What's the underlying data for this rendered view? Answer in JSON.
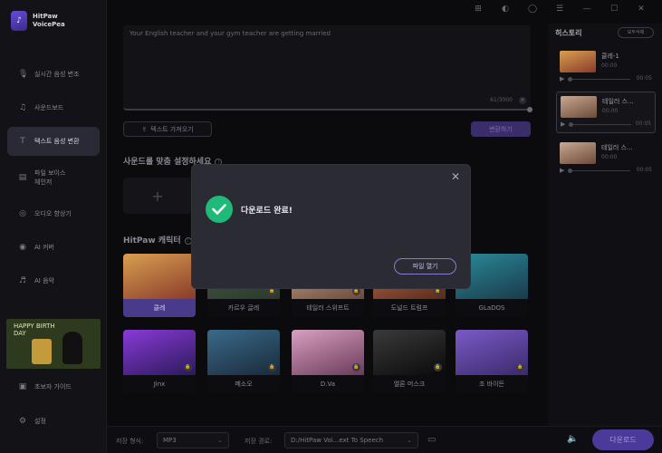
{
  "app": {
    "name_line1": "HitPaw",
    "name_line2": "VoicePea"
  },
  "sidebar": {
    "items": [
      {
        "label": "실시간 음성 변조",
        "icon": "mic-icon"
      },
      {
        "label": "사운드보드",
        "icon": "soundboard-icon"
      },
      {
        "label": "텍스트 음성 변환",
        "icon": "text-speech-icon",
        "active": true
      },
      {
        "label_line1": "파일 보이스",
        "label_line2": "체인저",
        "icon": "file-voice-icon"
      },
      {
        "label": "오디오 향상기",
        "icon": "audio-enhance-icon"
      },
      {
        "label": "AI 커버",
        "icon": "ai-cover-icon"
      },
      {
        "label": "AI 음악",
        "icon": "ai-music-icon"
      }
    ],
    "promo": {
      "line1": "HAPPY BIRTH",
      "line2": "DAY"
    },
    "guide": "초보자 가이드",
    "settings": "설정"
  },
  "editor": {
    "text": "Your English teacher and your gym teacher are getting married",
    "count": "61/3000",
    "import_label": "텍스트 가져오기",
    "convert_label": "변환하기"
  },
  "sound_section": {
    "title": "사운드를 맞춤 설정하세요"
  },
  "characters_section": {
    "title": "HitPaw 캐릭터",
    "items": [
      {
        "name": "클레",
        "color1": "#d8a050",
        "color2": "#8a3a2a",
        "selected": true
      },
      {
        "name": "카르우 글레",
        "color1": "#4a5a4a",
        "color2": "#2a3a2a",
        "lock": true
      },
      {
        "name": "테일러 스위프트",
        "color1": "#caa890",
        "color2": "#6a4a3a",
        "lock": true
      },
      {
        "name": "도널드 트럼프",
        "color1": "#c07050",
        "color2": "#5a2a1a",
        "lock": true
      },
      {
        "name": "GLaDOS",
        "color1": "#2a8a9a",
        "color2": "#1a3a4a"
      },
      {
        "name": "Jinx",
        "color1": "#8a3ad8",
        "color2": "#2a1a5a",
        "lock": true
      },
      {
        "name": "메소오",
        "color1": "#3a6a8a",
        "color2": "#1a2a3a",
        "lock": true
      },
      {
        "name": "D.Va",
        "color1": "#d8a0c0",
        "color2": "#6a3a5a",
        "lock": true
      },
      {
        "name": "엘론 머스크",
        "color1": "#3a3a3a",
        "color2": "#0a0a0a",
        "lock": true
      },
      {
        "name": "조 바이든",
        "color1": "#7a5ac8",
        "color2": "#3a2a6a",
        "lock": true
      }
    ]
  },
  "bottom_bar": {
    "format_label": "저장 형식:",
    "format_value": "MP3",
    "path_label": "저장 경로:",
    "path_value": "D:/HitPaw Voi...ext To Speech",
    "download_label": "다운로드"
  },
  "history": {
    "title": "히스토리",
    "clear_label": "모두삭제",
    "items": [
      {
        "name": "클레-1",
        "time": "00:00",
        "duration": "00:05",
        "color1": "#d8a050",
        "color2": "#8a3a2a"
      },
      {
        "name": "테일러 스...",
        "time": "00:00",
        "duration": "00:05",
        "color1": "#caa890",
        "color2": "#6a4a3a",
        "active": true
      },
      {
        "name": "테일러 스...",
        "time": "00:00",
        "duration": "00:05",
        "color1": "#caa890",
        "color2": "#6a4a3a"
      }
    ]
  },
  "modal": {
    "message": "다운로드 완료!",
    "button": "파일 열기"
  },
  "colors": {
    "accent": "#4c3a9a",
    "success": "#1fb97a"
  }
}
